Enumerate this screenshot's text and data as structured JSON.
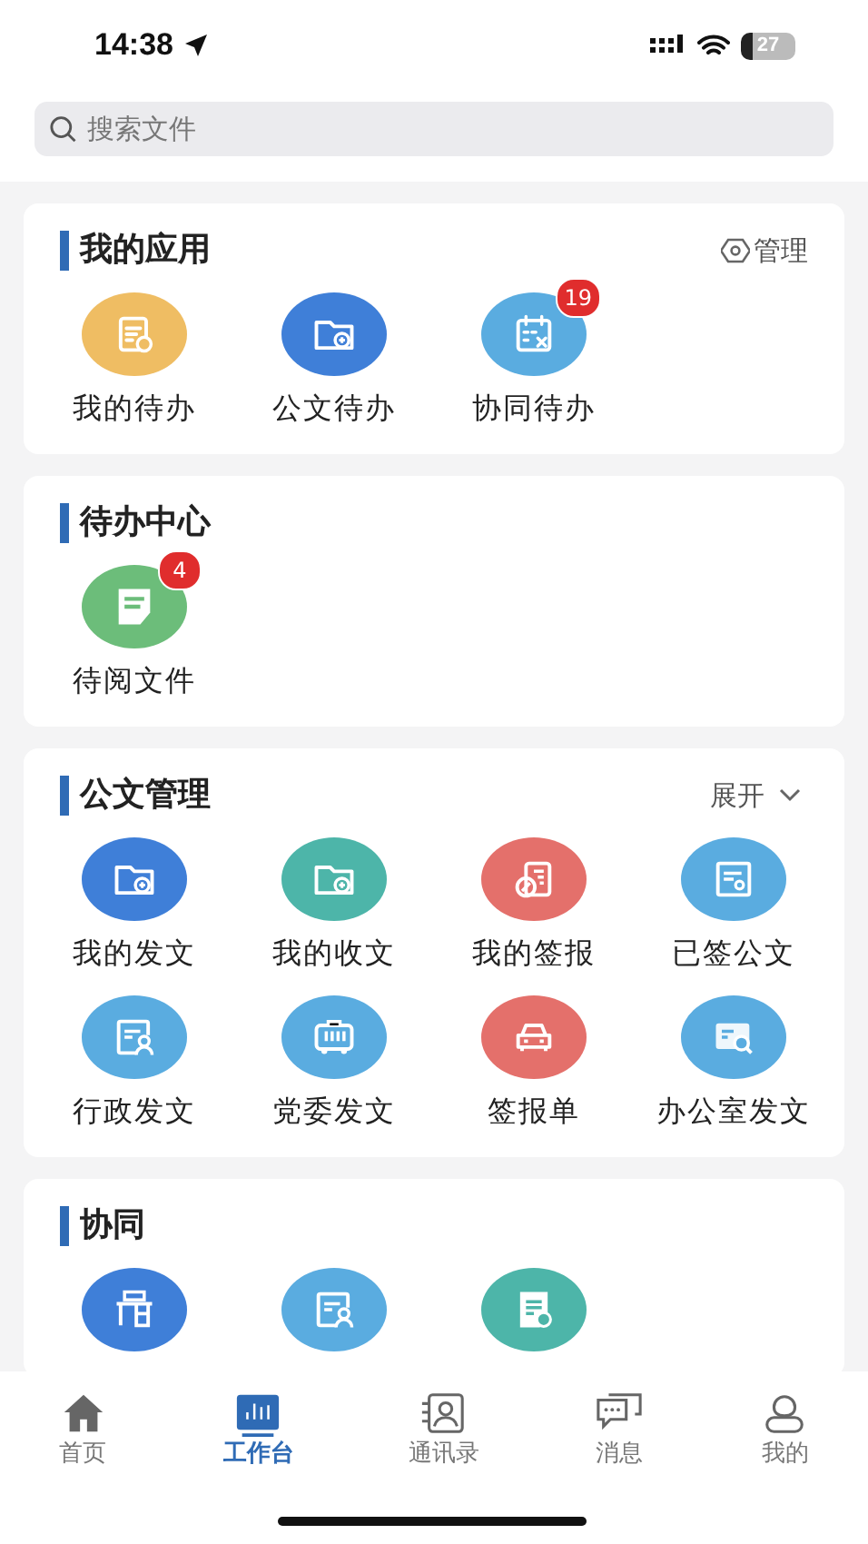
{
  "status_bar": {
    "time": "14:38",
    "battery": "27"
  },
  "search": {
    "placeholder": "搜索文件"
  },
  "sections": [
    {
      "title": "我的应用",
      "action": {
        "kind": "manage",
        "label": "管理"
      },
      "items": [
        {
          "label": "我的待办",
          "kind": "doc",
          "color": "#efbd63"
        },
        {
          "label": "公文待办",
          "kind": "folder",
          "color": "#3f7fd8"
        },
        {
          "label": "协同待办",
          "kind": "calendar",
          "color": "#5aace0",
          "badge": "19"
        }
      ]
    },
    {
      "title": "待办中心",
      "items": [
        {
          "label": "待阅文件",
          "kind": "note",
          "color": "#6cbd7a",
          "badge": "4"
        }
      ]
    },
    {
      "title": "公文管理",
      "action": {
        "kind": "expand",
        "label": "展开"
      },
      "items": [
        {
          "label": "我的发文",
          "kind": "folder",
          "color": "#3f7fd8"
        },
        {
          "label": "我的收文",
          "kind": "folder",
          "color": "#4db5a9"
        },
        {
          "label": "我的签报",
          "kind": "stamp",
          "color": "#e4706b"
        },
        {
          "label": "已签公文",
          "kind": "cert",
          "color": "#5aace0"
        },
        {
          "label": "行政发文",
          "kind": "person",
          "color": "#5aace0"
        },
        {
          "label": "党委发文",
          "kind": "bus",
          "color": "#5aace0"
        },
        {
          "label": "签报单",
          "kind": "car",
          "color": "#e4706b"
        },
        {
          "label": "办公室发文",
          "kind": "search",
          "color": "#5aace0"
        }
      ]
    },
    {
      "title": "协同",
      "items": [
        {
          "kind": "desk",
          "color": "#3f7fd8"
        },
        {
          "kind": "person",
          "color": "#5aace0"
        },
        {
          "kind": "check",
          "color": "#4db5a9"
        }
      ]
    }
  ],
  "tabs": [
    {
      "label": "首页",
      "kind": "home",
      "selected": false
    },
    {
      "label": "工作台",
      "kind": "chart",
      "selected": true
    },
    {
      "label": "通讯录",
      "kind": "contacts",
      "selected": false
    },
    {
      "label": "消息",
      "kind": "chat",
      "selected": false
    },
    {
      "label": "我的",
      "kind": "user",
      "selected": false
    }
  ]
}
